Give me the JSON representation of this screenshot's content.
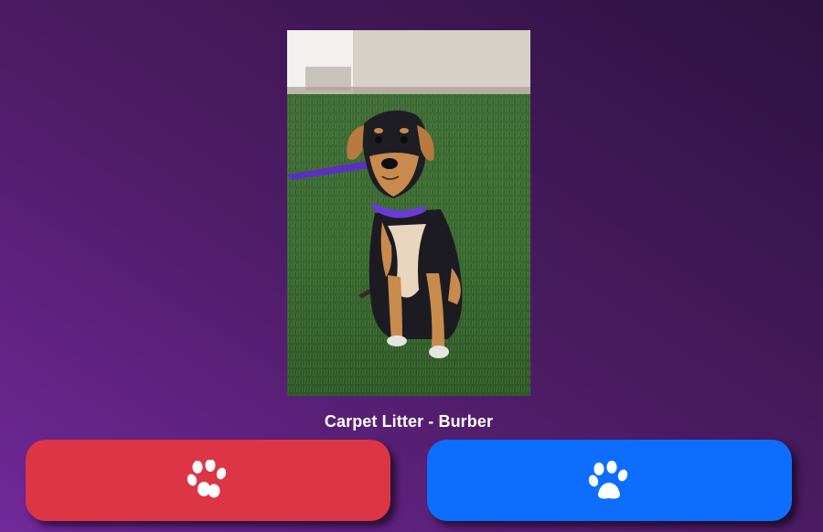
{
  "pet": {
    "name": "Carpet Litter - Burber",
    "photo_alt": "Black and tan puppy with purple leash sitting on grass"
  },
  "buttons": {
    "left": {
      "color": "#dc3545",
      "icon": "paw-icon"
    },
    "right": {
      "color": "#0d6efd",
      "icon": "paw-icon"
    }
  }
}
